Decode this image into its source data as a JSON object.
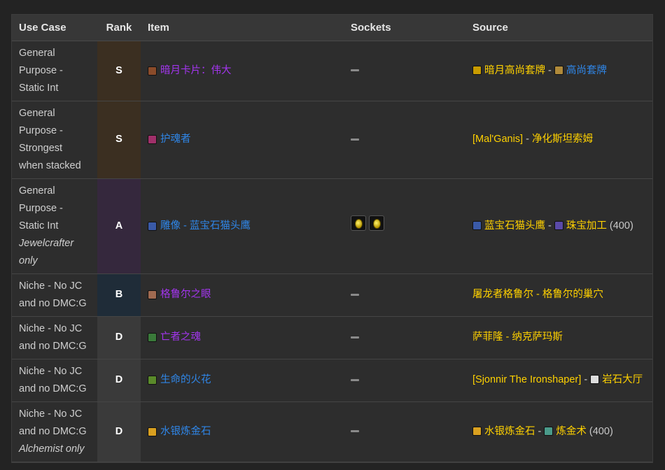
{
  "headers": {
    "use_case": "Use Case",
    "rank": "Rank",
    "item": "Item",
    "sockets": "Sockets",
    "source": "Source"
  },
  "rows": [
    {
      "use_case": [
        "General",
        "Purpose -",
        "Static Int"
      ],
      "note": "",
      "rank": "S",
      "item": {
        "name": "暗月卡片：伟大",
        "quality": "epic",
        "icon": "darkmoon-card-icon",
        "icon_color": "#8a4b2a"
      },
      "sockets": 0,
      "source": [
        {
          "text": "暗月高尚套牌",
          "cls": "gold",
          "icon": "quest-exclamation-icon"
        },
        {
          "text": " - ",
          "cls": "gray"
        },
        {
          "text": "高尚套牌",
          "cls": "rare",
          "icon": "card-deck-icon"
        }
      ]
    },
    {
      "use_case": [
        "General",
        "Purpose -",
        "Strongest",
        "when stacked"
      ],
      "note": "",
      "rank": "S",
      "item": {
        "name": "护魂者",
        "quality": "rare",
        "icon": "soul-preserver-icon",
        "icon_color": "#a0306a"
      },
      "sockets": 0,
      "source": [
        {
          "text": "[Mal'Ganis]",
          "cls": "gold"
        },
        {
          "text": " - ",
          "cls": "gray"
        },
        {
          "text": "净化斯坦索姆",
          "cls": "gold"
        }
      ]
    },
    {
      "use_case": [
        "General",
        "Purpose -",
        "Static Int"
      ],
      "note": "Jewelcrafter only",
      "rank": "A",
      "item": {
        "name": "雕像 - 蓝宝石猫头鹰",
        "quality": "rare",
        "icon": "sapphire-owl-icon",
        "icon_color": "#3a5aa8"
      },
      "sockets": 2,
      "source": [
        {
          "text": "蓝宝石猫头鹰",
          "cls": "gold",
          "icon": "sapphire-owl-icon"
        },
        {
          "text": " - ",
          "cls": "gray"
        },
        {
          "text": "珠宝加工",
          "cls": "gold",
          "icon": "jewelcrafting-icon"
        },
        {
          "text": " (400)",
          "cls": "gray"
        }
      ]
    },
    {
      "use_case": [
        "Niche - No JC",
        "and no DMC:G"
      ],
      "note": "",
      "rank": "B",
      "item": {
        "name": "格鲁尔之眼",
        "quality": "epic",
        "icon": "eye-of-gruul-icon",
        "icon_color": "#a06a50"
      },
      "sockets": 0,
      "source": [
        {
          "text": "屠龙者格鲁尔 - 格鲁尔的巢穴",
          "cls": "gold"
        }
      ]
    },
    {
      "use_case": [
        "Niche - No JC",
        "and no DMC:G"
      ],
      "note": "",
      "rank": "D",
      "item": {
        "name": "亡者之魂",
        "quality": "epic",
        "icon": "spirit-of-the-dead-icon",
        "icon_color": "#3a7a3a"
      },
      "sockets": 0,
      "source": [
        {
          "text": "萨菲隆 - 纳克萨玛斯",
          "cls": "gold"
        }
      ]
    },
    {
      "use_case": [
        "Niche - No JC",
        "and no DMC:G"
      ],
      "note": "",
      "rank": "D",
      "item": {
        "name": "生命的火花",
        "quality": "rare",
        "icon": "spark-of-life-icon",
        "icon_color": "#5a8a2a"
      },
      "sockets": 0,
      "source": [
        {
          "text": "[Sjonnir The Ironshaper]",
          "cls": "gold"
        },
        {
          "text": " - ",
          "cls": "gray"
        },
        {
          "text": "岩石大厅",
          "cls": "gold",
          "icon": "skull-icon"
        }
      ]
    },
    {
      "use_case": [
        "Niche - No JC",
        "and no DMC:G"
      ],
      "note": "Alchemist only",
      "rank": "D",
      "item": {
        "name": "水银炼金石",
        "quality": "rare",
        "icon": "mercurial-alchemist-stone-icon",
        "icon_color": "#d9a020"
      },
      "sockets": 0,
      "source": [
        {
          "text": "水银炼金石",
          "cls": "gold",
          "icon": "mercurial-alchemist-stone-icon"
        },
        {
          "text": " - ",
          "cls": "gray"
        },
        {
          "text": "炼金术",
          "cls": "gold",
          "icon": "alchemy-icon"
        },
        {
          "text": " (400)",
          "cls": "gray"
        }
      ]
    }
  ]
}
